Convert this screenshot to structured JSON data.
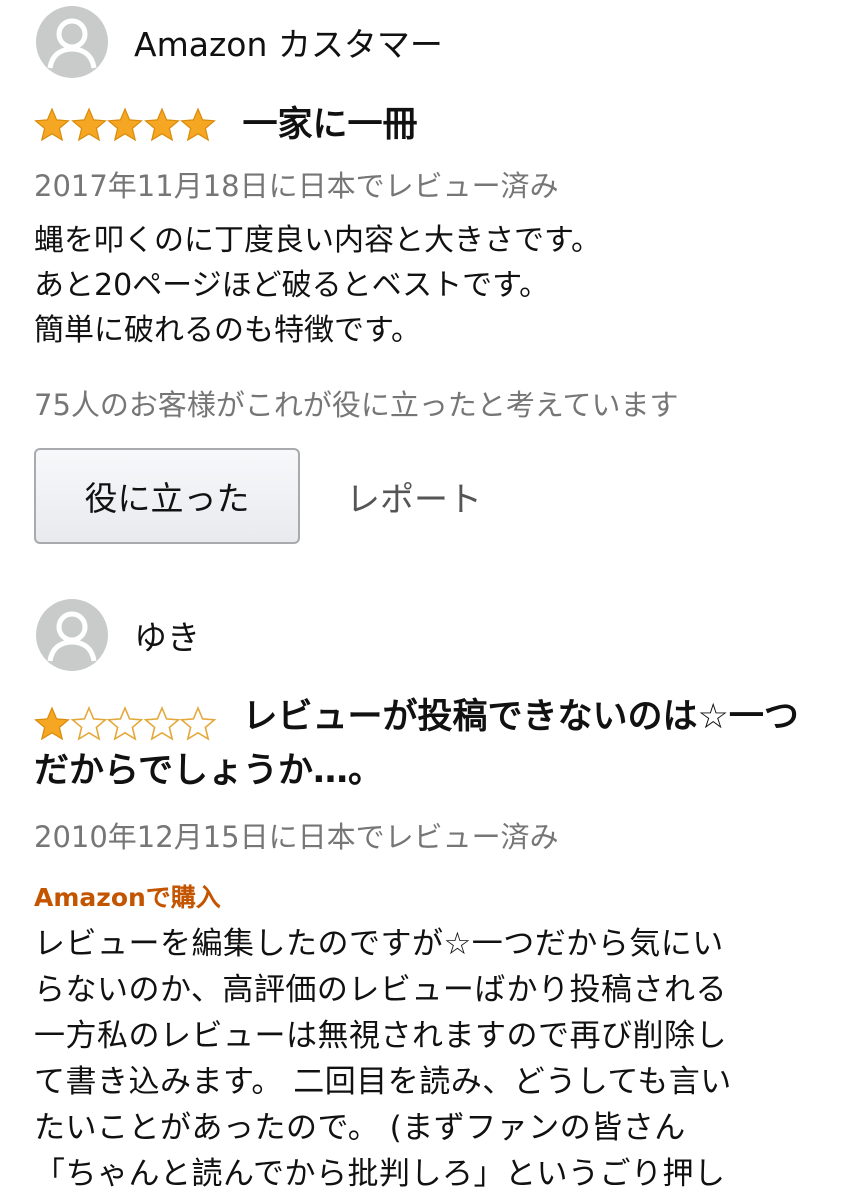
{
  "reviews": [
    {
      "reviewer": "Amazon カスタマー",
      "rating": 5,
      "rating_max": 5,
      "title": "一家に一冊",
      "date": "2017年11月18日に日本でレビュー済み",
      "body_lines": [
        "蝿を叩くのに丁度良い内容と大きさです。",
        "あと20ページほど破るとベストです。",
        "簡単に破れるのも特徴です。"
      ],
      "helpful_count_text": "75人のお客様がこれが役に立ったと考えています",
      "helpful_button": "役に立った",
      "report_link": "レポート"
    },
    {
      "reviewer": "ゆき",
      "rating": 1,
      "rating_max": 5,
      "title": "レビューが投稿できないのは☆一つだからでしょうか…。",
      "date": "2010年12月15日に日本でレビュー済み",
      "verified_badge": "Amazonで購入",
      "body_lines": [
        "レビューを編集したのですが☆一つだから気にい",
        "らないのか、高評価のレビューばかり投稿される",
        "一方私のレビューは無視されますので再び削除し",
        "て書き込みます。 二回目を読み、どうしても言い",
        "たいことがあったので。 (まずファンの皆さん",
        "「ちゃんと読んでから批判しろ」というごり押し"
      ]
    }
  ],
  "colors": {
    "star_filled": "#f5a623",
    "star_outline": "#e4a83a",
    "verified_badge": "#c45500",
    "meta_text": "#767676",
    "avatar_bg": "#c9cbcb"
  },
  "icons": {
    "avatar": "user-silhouette-icon",
    "star": "star-icon"
  }
}
